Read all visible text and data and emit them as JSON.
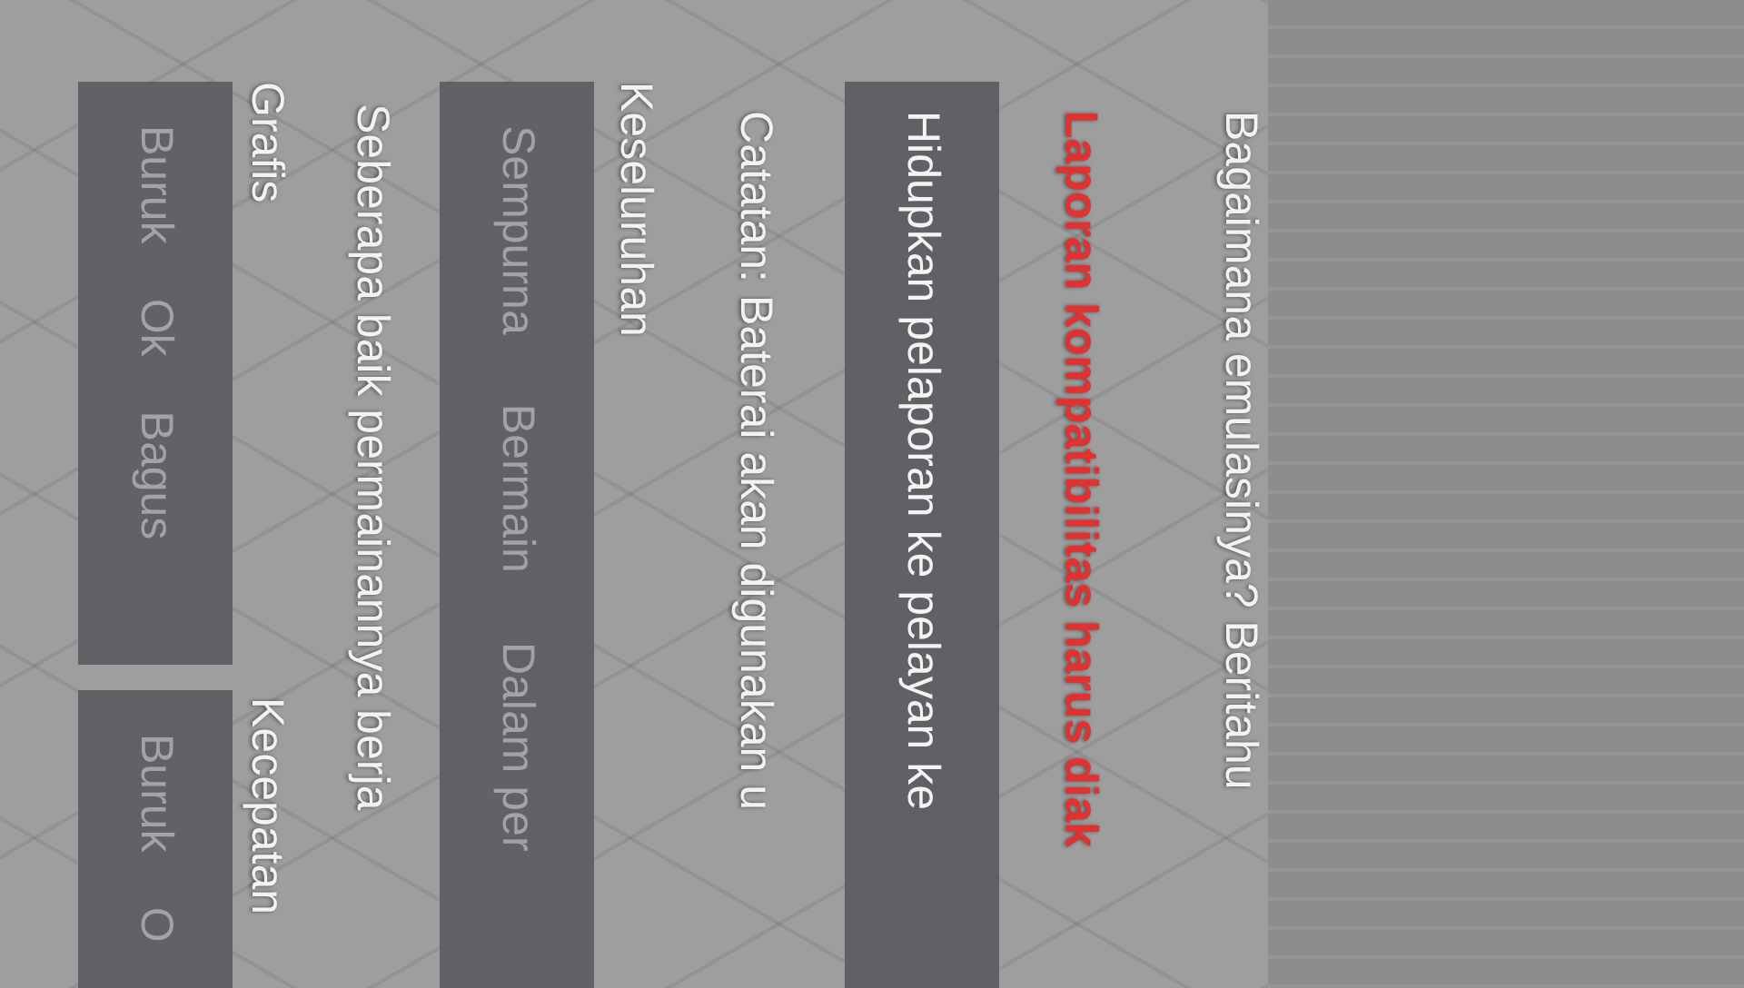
{
  "prompt": "Bagaimana emulasinya? Beritahu",
  "warning": "Laporan kompatibilitas harus diak",
  "enable_button": {
    "label": "Hidupkan pelaporan ke pelayan ke"
  },
  "note": "Catatan: Baterai akan digunakan u",
  "overall": {
    "label": "Keseluruhan",
    "options": [
      {
        "label": "Sempurna",
        "selected": false
      },
      {
        "label": "Bermain",
        "selected": false
      },
      {
        "label": "Dalam per",
        "selected": false
      }
    ]
  },
  "question": "Seberapa baik permainannya berja",
  "ratings": [
    {
      "label": "Grafis",
      "options": [
        {
          "label": "Buruk",
          "selected": false
        },
        {
          "label": "Ok",
          "selected": false
        },
        {
          "label": "Bagus",
          "selected": false
        }
      ]
    },
    {
      "label": "Kecepatan",
      "options": [
        {
          "label": "Buruk",
          "selected": false
        },
        {
          "label": "O",
          "selected": false
        }
      ]
    }
  ]
}
